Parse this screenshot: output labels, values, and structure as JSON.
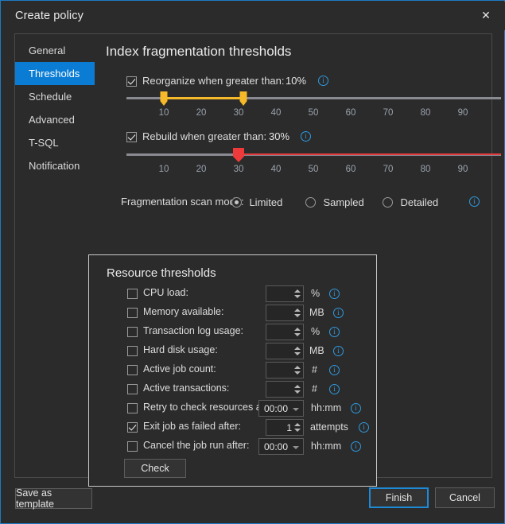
{
  "window": {
    "title": "Create policy",
    "close_label": "✕",
    "accent": "#1e7ac4"
  },
  "nav": {
    "items": [
      {
        "label": "General",
        "active": false
      },
      {
        "label": "Thresholds",
        "active": true
      },
      {
        "label": "Schedule",
        "active": false
      },
      {
        "label": "Advanced",
        "active": false
      },
      {
        "label": "T-SQL",
        "active": false
      },
      {
        "label": "Notification",
        "active": false
      }
    ]
  },
  "content": {
    "heading": "Index fragmentation thresholds",
    "info_glyph": "i",
    "reorganize": {
      "label": "Reorganize when greater than:",
      "checked": true,
      "value": "10%",
      "handle_color": "#f5b92a",
      "range_start": 10,
      "range_end": 30,
      "ticks": [
        "10",
        "20",
        "30",
        "40",
        "50",
        "60",
        "70",
        "80",
        "90"
      ]
    },
    "rebuild": {
      "label": "Rebuild when greater than:",
      "checked": true,
      "value": "30%",
      "handle_color": "#ee3a3a",
      "marker": 30,
      "ticks": [
        "10",
        "20",
        "30",
        "40",
        "50",
        "60",
        "70",
        "80",
        "90"
      ]
    },
    "scan_mode": {
      "label": "Fragmentation scan mode:",
      "options": [
        {
          "label": "Limited",
          "selected": true
        },
        {
          "label": "Sampled",
          "selected": false
        },
        {
          "label": "Detailed",
          "selected": false
        }
      ]
    },
    "resource_thresholds": {
      "title": "Resource thresholds",
      "rows": [
        {
          "label": "CPU load:",
          "checked": false,
          "control": "spin",
          "value": "",
          "unit": "%"
        },
        {
          "label": "Memory available:",
          "checked": false,
          "control": "spin",
          "value": "",
          "unit": "MB"
        },
        {
          "label": "Transaction log usage:",
          "checked": false,
          "control": "spin",
          "value": "",
          "unit": "%"
        },
        {
          "label": "Hard disk usage:",
          "checked": false,
          "control": "spin",
          "value": "",
          "unit": "MB"
        },
        {
          "label": "Active job count:",
          "checked": false,
          "control": "spin",
          "value": "",
          "unit": "#"
        },
        {
          "label": "Active transactions:",
          "checked": false,
          "control": "spin",
          "value": "",
          "unit": "#"
        },
        {
          "label": "Retry to check resources after:",
          "checked": false,
          "control": "combo",
          "value": "00:00",
          "unit": "hh:mm"
        },
        {
          "label": "Exit job as failed after:",
          "checked": true,
          "control": "spin",
          "value": "1",
          "unit": "attempts"
        },
        {
          "label": "Cancel the job run after:",
          "checked": false,
          "control": "combo",
          "value": "00:00",
          "unit": "hh:mm"
        }
      ],
      "check_button": "Check"
    }
  },
  "footer": {
    "save_as_template": "Save as template",
    "finish": "Finish",
    "cancel": "Cancel"
  }
}
